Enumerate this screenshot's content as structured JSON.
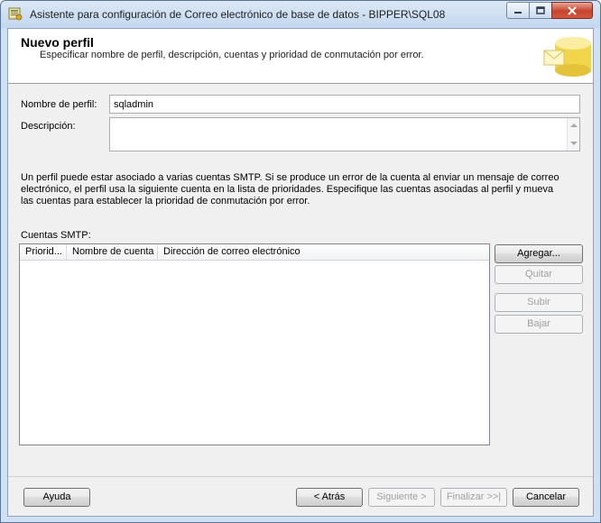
{
  "window": {
    "title": "Asistente para configuración de Correo electrónico de base de datos - BIPPER\\SQL08",
    "controls": {
      "minimize_icon": "minimize-icon",
      "maximize_icon": "maximize-icon",
      "close_icon": "close-icon"
    }
  },
  "header": {
    "title": "Nuevo perfil",
    "subtitle": "Especificar nombre de perfil, descripción, cuentas y prioridad de conmutación por error."
  },
  "form": {
    "profile_name_label": "Nombre de perfil:",
    "profile_name_value": "sqladmin",
    "description_label": "Descripción:",
    "description_value": ""
  },
  "info_text": "Un perfil puede estar asociado a varias cuentas SMTP. Si se produce un error de la cuenta al enviar un mensaje de correo electrónico, el perfil usa la siguiente cuenta en la lista de prioridades. Especifique las cuentas asociadas al perfil y mueva las cuentas para establecer la prioridad de conmutación por error.",
  "smtp": {
    "label": "Cuentas SMTP:",
    "columns": [
      "Priorid...",
      "Nombre de cuenta",
      "Dirección de correo electrónico"
    ],
    "rows": []
  },
  "side_buttons": {
    "add": "Agregar...",
    "remove": "Quitar",
    "up": "Subir",
    "down": "Bajar"
  },
  "footer": {
    "help": "Ayuda",
    "back": "< Atrás",
    "next": "Siguiente >",
    "finish": "Finalizar >>|",
    "cancel": "Cancelar"
  },
  "colors": {
    "window_frame": "#cfe0f3",
    "close_button": "#c8442f",
    "disabled_text": "#a0a0a0"
  }
}
